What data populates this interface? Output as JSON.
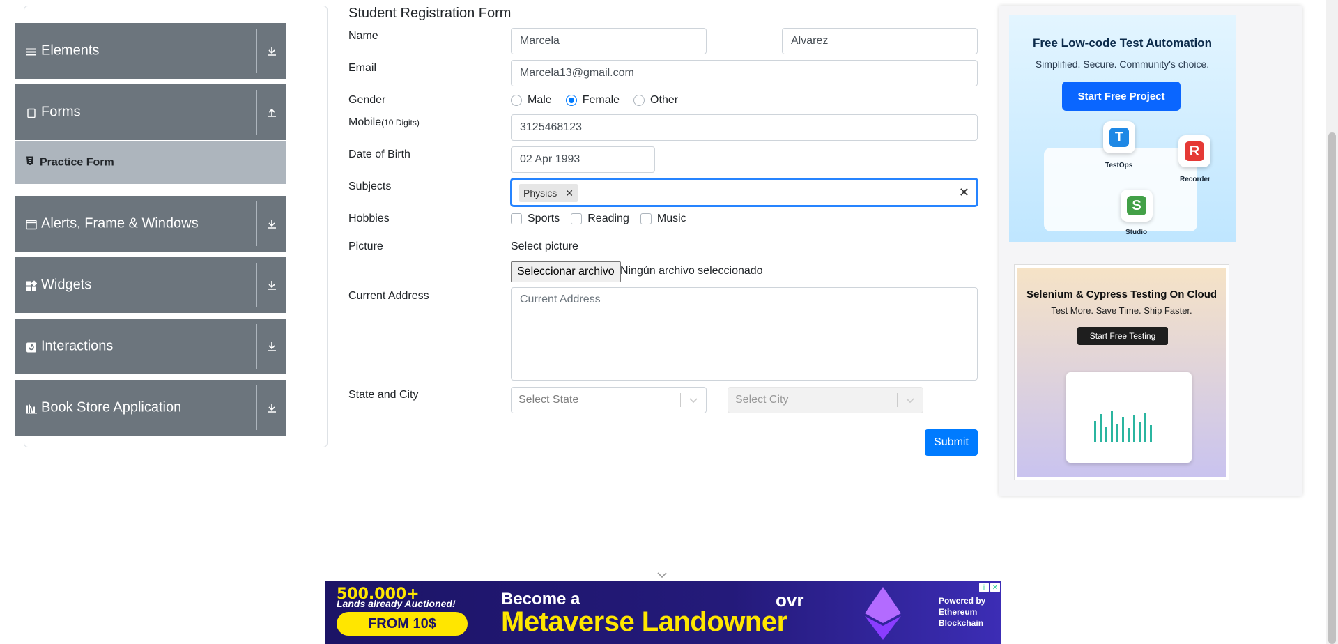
{
  "sidebar": {
    "groups": [
      {
        "label": "Elements",
        "icon": "hamburger-icon",
        "arrow": "download-arrow-icon"
      },
      {
        "label": "Forms",
        "icon": "document-icon",
        "arrow": "upload-arrow-icon"
      },
      {
        "label": "Alerts, Frame & Windows",
        "icon": "window-icon",
        "arrow": "download-arrow-icon"
      },
      {
        "label": "Widgets",
        "icon": "widgets-icon",
        "arrow": "download-arrow-icon"
      },
      {
        "label": "Interactions",
        "icon": "interactions-icon",
        "arrow": "download-arrow-icon"
      },
      {
        "label": "Book Store Application",
        "icon": "books-icon",
        "arrow": "download-arrow-icon"
      }
    ],
    "active_item": {
      "label": "Practice Form",
      "icon": "html-file-icon"
    }
  },
  "form": {
    "title": "Student Registration Form",
    "labels": {
      "name": "Name",
      "email": "Email",
      "gender": "Gender",
      "mobile": "Mobile",
      "mobile_hint": "(10 Digits)",
      "dob": "Date of Birth",
      "subjects": "Subjects",
      "hobbies": "Hobbies",
      "picture": "Picture",
      "address": "Current Address",
      "state_city": "State and City"
    },
    "first_name": "Marcela",
    "last_name": "Alvarez",
    "email": "Marcela13@gmail.com",
    "gender_options": [
      "Male",
      "Female",
      "Other"
    ],
    "gender_selected": "Female",
    "mobile": "3125468123",
    "dob": "02 Apr 1993",
    "subjects": [
      "Physics"
    ],
    "hobbies": [
      "Sports",
      "Reading",
      "Music"
    ],
    "picture_label": "Select picture",
    "file_button": "Seleccionar archivo",
    "file_status": "Ningún archivo seleccionado",
    "address_placeholder": "Current Address",
    "state_placeholder": "Select State",
    "city_placeholder": "Select City",
    "submit": "Submit"
  },
  "ads": {
    "ad1": {
      "title": "Free Low-code Test Automation",
      "subtitle": "Simplified. Secure. Community's choice.",
      "button": "Start Free Project",
      "tiles": [
        "TestOps",
        "Recorder",
        "Studio"
      ]
    },
    "ad2": {
      "title": "Selenium & Cypress Testing On Cloud",
      "subtitle": "Test More. Save Time. Ship Faster.",
      "button": "Start Free Testing"
    },
    "banner": {
      "count": "500.000+",
      "count_sub": "Lands already Auctioned!",
      "price": "FROM 10$",
      "headline1": "Become a",
      "headline2": "Metaverse Landowner",
      "brand": "ovr",
      "powered": [
        "Powered by",
        "Ethereum",
        "Blockchain"
      ]
    }
  },
  "colors": {
    "accent": "#007bff",
    "sidebar_bg": "#6c757d",
    "active_item_bg": "#adb5bd"
  }
}
